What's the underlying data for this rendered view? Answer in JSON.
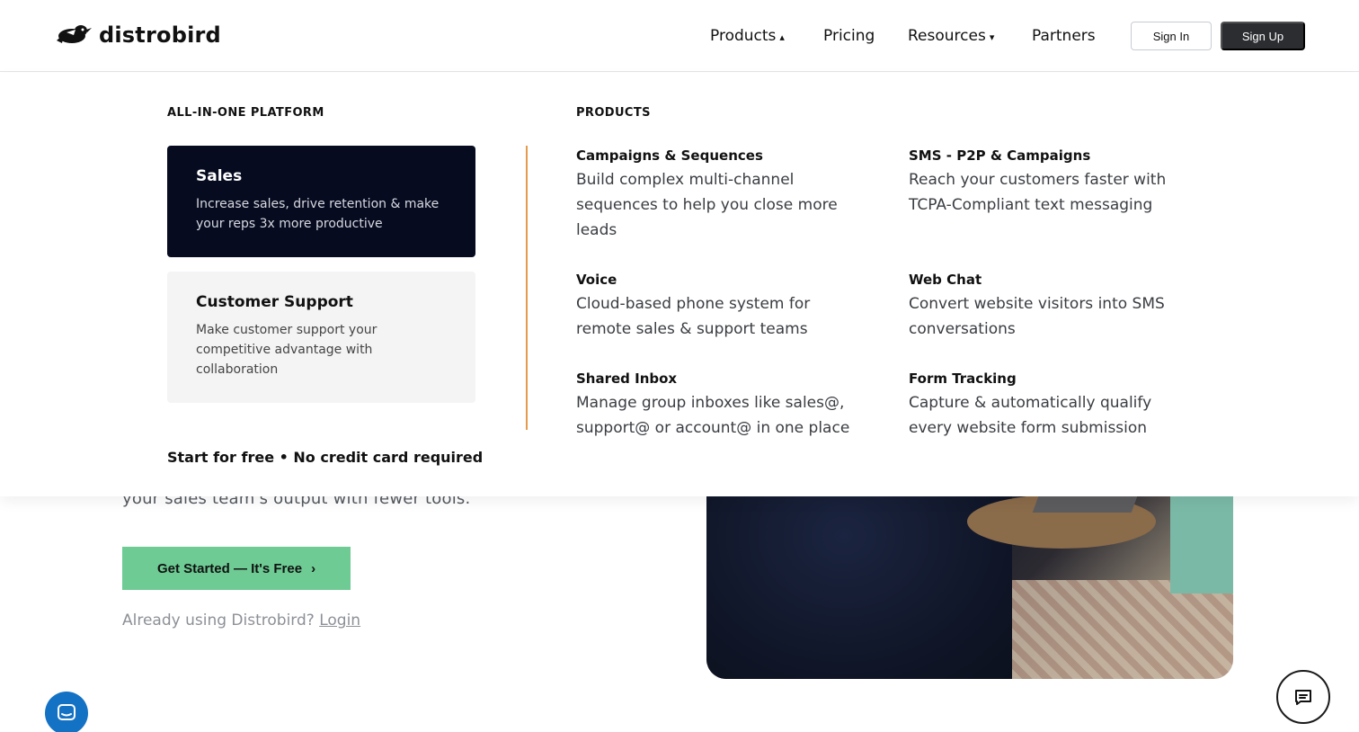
{
  "brand": {
    "name": "distrobird"
  },
  "nav": {
    "items": [
      {
        "label": "Products",
        "caret": "▴"
      },
      {
        "label": "Pricing"
      },
      {
        "label": "Resources",
        "caret": "▾"
      },
      {
        "label": "Partners"
      }
    ],
    "sign_in": "Sign In",
    "sign_up": "Sign Up"
  },
  "menu": {
    "platform_heading": "ALL-IN-ONE PLATFORM",
    "platform_cards": [
      {
        "title": "Sales",
        "desc": "Increase sales, drive retention & make your reps 3x more productive"
      },
      {
        "title": "Customer Support",
        "desc": "Make customer support your competitive advantage with collaboration"
      }
    ],
    "start_free": "Start for free • No credit card required",
    "products_heading": "PRODUCTS",
    "products": [
      {
        "title": "Campaigns & Sequences",
        "desc": "Build complex multi-channel sequences to help you close more leads"
      },
      {
        "title": "SMS - P2P & Campaigns",
        "desc": "Reach your customers faster with TCPA-Compliant text messaging"
      },
      {
        "title": "Voice",
        "desc": "Cloud-based phone system for remote sales & support teams"
      },
      {
        "title": "Web Chat",
        "desc": "Convert website visitors into SMS conversations"
      },
      {
        "title": "Shared Inbox",
        "desc": "Manage group inboxes like sales@, support@ or account@ in one place"
      },
      {
        "title": "Form Tracking",
        "desc": "Capture & automatically qualify every website form submission"
      }
    ]
  },
  "hero": {
    "subtitle_tail": "your sales team's output with fewer tools.",
    "cta_label": "Get Started — It's Free",
    "cta_icon": "chevron-right-icon",
    "already_text": "Already using Distrobird?",
    "login_link": "Login"
  },
  "widgets": {
    "left_chat_icon": "chat-bubble-icon",
    "right_chat_icon": "message-icon"
  },
  "colors": {
    "accent_green": "#6dcb93",
    "divider_orange": "#e69a4b",
    "sales_card_bg": "#060b20",
    "chat_blue": "#1472c4"
  }
}
